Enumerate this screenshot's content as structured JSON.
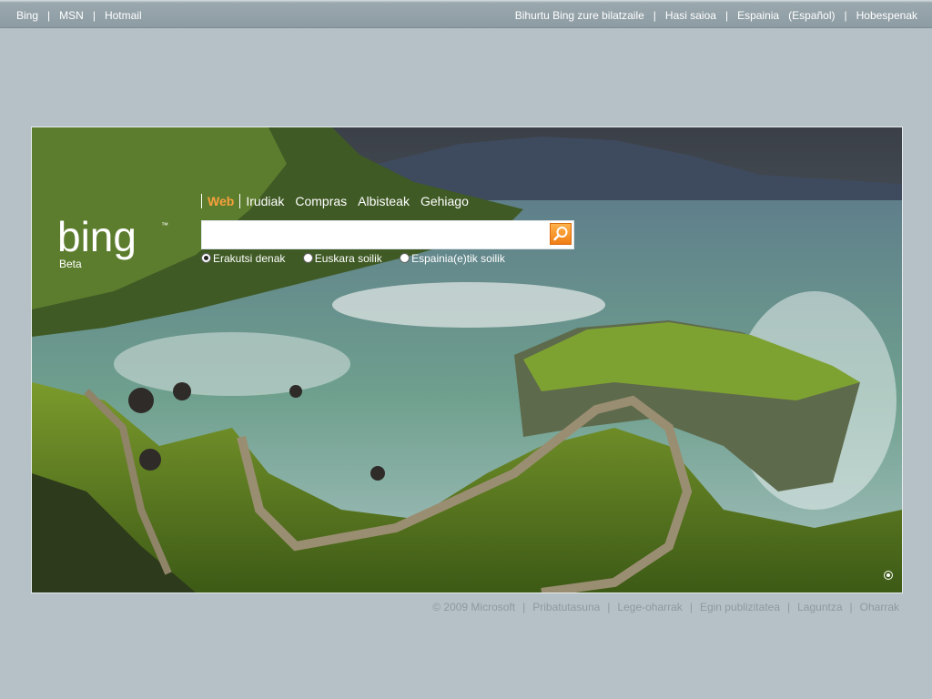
{
  "topbar": {
    "left_links": [
      "Bing",
      "MSN",
      "Hotmail"
    ],
    "right_links": [
      "Bihurtu Bing zure bilatzaile",
      "Hasi saioa",
      "Espainia",
      "(Español)",
      "Hobespenak"
    ],
    "separator": "|"
  },
  "logo": {
    "text": "bing",
    "tm": "™",
    "beta": "Beta"
  },
  "scopes": {
    "items": [
      "Web",
      "Irudiak",
      "Compras",
      "Albisteak",
      "Gehiago"
    ],
    "active": "Web"
  },
  "search": {
    "value": "",
    "placeholder": ""
  },
  "radios": {
    "options": [
      "Erakutsi denak",
      "Euskara soilik",
      "Espainia(e)tik soilik"
    ],
    "selected": 0
  },
  "footer": {
    "items": [
      "© 2009 Microsoft",
      "Pribatutasuna",
      "Lege-oharrak",
      "Egin publizitatea",
      "Laguntza",
      "Oharrak"
    ],
    "separator": "|"
  },
  "colors": {
    "background": "#b5c1c6",
    "topbar": "#8d9ca3",
    "accent_orange": "#f8a13c",
    "footer_text": "#8e9aa0"
  }
}
